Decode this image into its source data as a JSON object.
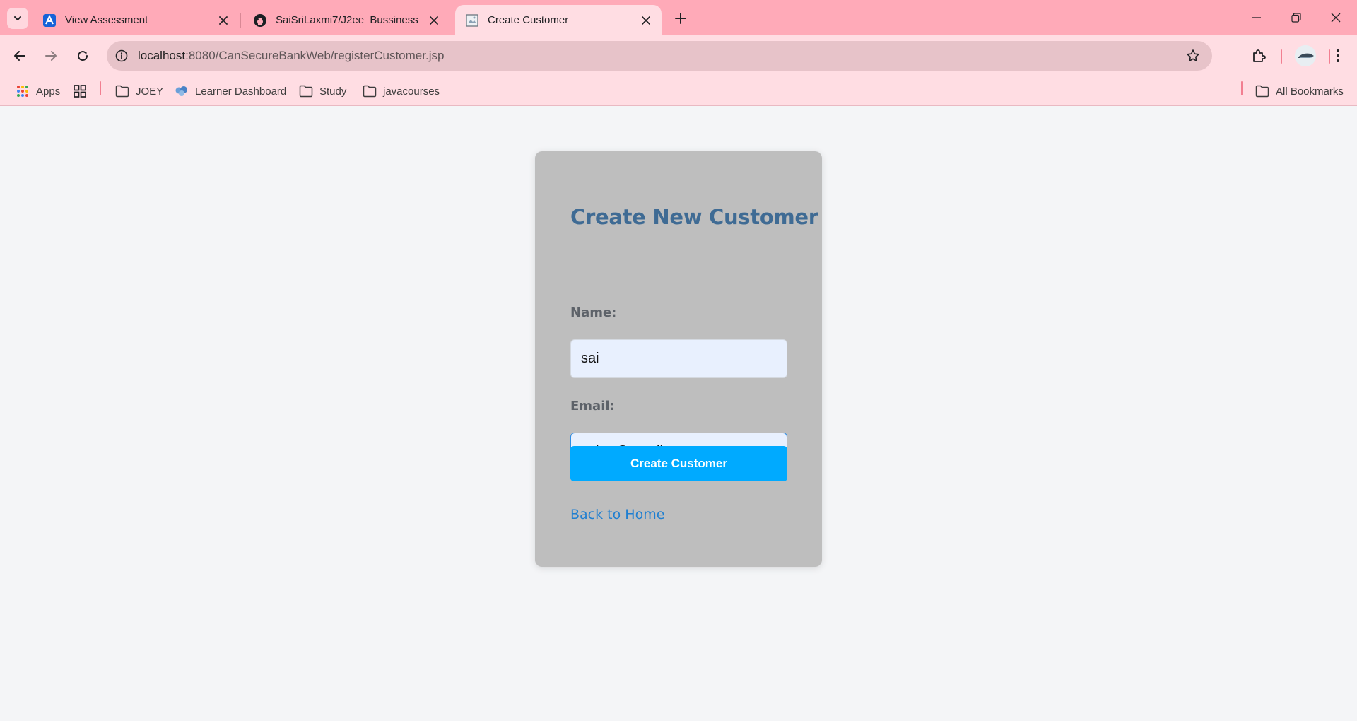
{
  "browser": {
    "tabs": [
      {
        "title": "View Assessment",
        "favicon": "assessment-logo-icon",
        "active": false
      },
      {
        "title": "SaiSriLaxmi7/J2ee_Bussiness_LA",
        "favicon": "github-icon",
        "active": false
      },
      {
        "title": "Create Customer",
        "favicon": "page-icon",
        "active": true
      }
    ],
    "address": {
      "host": "localhost",
      "path": ":8080/CanSecureBankWeb/registerCustomer.jsp"
    },
    "bookmarks": [
      {
        "label": "Apps",
        "icon": "apps-grid-icon"
      },
      {
        "label": "",
        "icon": "tab-groups-icon"
      },
      {
        "label": "JOEY",
        "icon": "folder-icon"
      },
      {
        "label": "Learner Dashboard",
        "icon": "learner-icon"
      },
      {
        "label": "Study",
        "icon": "folder-icon"
      },
      {
        "label": "javacourses",
        "icon": "folder-icon"
      }
    ],
    "all_bookmarks": "All Bookmarks"
  },
  "form": {
    "title": "Create New Customer",
    "name_label": "Name:",
    "name_value": "sai",
    "email_label": "Email:",
    "email_value": "sai12@gmail.com",
    "submit_label": "Create Customer",
    "back_link": "Back to Home"
  },
  "colors": {
    "tabstrip": "#ffaab8",
    "toolbar": "#ffdde3",
    "card": "#bebebe",
    "title": "#3f6b94",
    "button": "#00aaff",
    "link": "#1f7fd1"
  }
}
